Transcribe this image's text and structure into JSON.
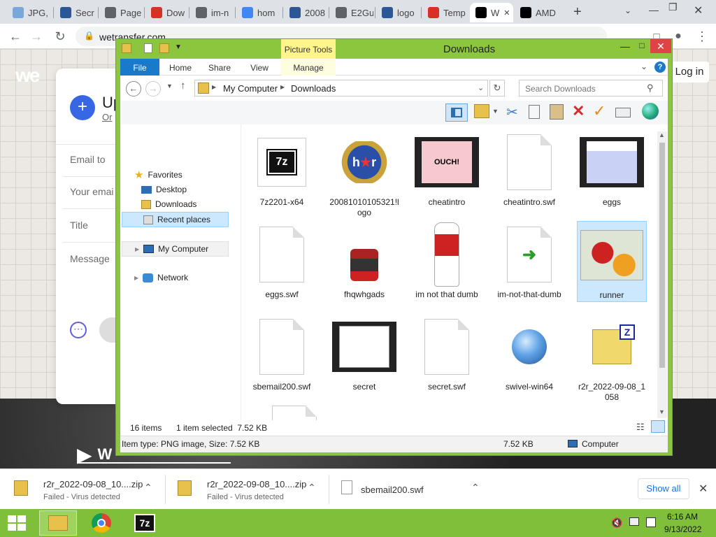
{
  "browser": {
    "tabs": [
      {
        "label": "JPG,",
        "icon": "image-icon",
        "color": "#7aa7d9"
      },
      {
        "label": "Secr",
        "icon": "site-icon",
        "color": "#2b5797"
      },
      {
        "label": "Page",
        "icon": "globe-icon",
        "color": "#5f6368"
      },
      {
        "label": "Dow",
        "icon": "download-icon",
        "color": "#d93025"
      },
      {
        "label": "im-n",
        "icon": "globe-icon",
        "color": "#5f6368"
      },
      {
        "label": "hom",
        "icon": "google-icon",
        "color": "#4285f4"
      },
      {
        "label": "2008",
        "icon": "site-icon",
        "color": "#2b5797"
      },
      {
        "label": "E2Gu",
        "icon": "globe-icon",
        "color": "#5f6368"
      },
      {
        "label": "logo",
        "icon": "site-icon",
        "color": "#2b5797"
      },
      {
        "label": "Temp",
        "icon": "mail-icon",
        "color": "#d93025"
      },
      {
        "label": "W",
        "icon": "wetransfer-icon",
        "color": "#000000"
      },
      {
        "label": "AMD",
        "icon": "amd-icon",
        "color": "#000000"
      }
    ],
    "url": "wetransfer.com"
  },
  "webpage": {
    "logo": "we",
    "login": "Log in",
    "upload_title": "Up",
    "upload_sub": "Or",
    "fields": [
      "Email to",
      "Your emai",
      "Title",
      "Message"
    ],
    "play_letter": "W"
  },
  "explorer": {
    "contextual_tab": "Picture Tools",
    "title": "Downloads",
    "ribbon_tabs": [
      "File",
      "Home",
      "Share",
      "View",
      "Manage"
    ],
    "breadcrumb": [
      "My Computer",
      "Downloads"
    ],
    "search_placeholder": "Search Downloads",
    "nav": {
      "favorites": "Favorites",
      "items": [
        "Desktop",
        "Downloads",
        "Recent places"
      ],
      "my_computer": "My Computer",
      "network": "Network"
    },
    "files": [
      {
        "name": "7z2201-x64",
        "kind": "app7z"
      },
      {
        "name": "20081010105321!logo",
        "kind": "logo"
      },
      {
        "name": "cheatintro",
        "kind": "film-pink"
      },
      {
        "name": "cheatintro.swf",
        "kind": "doc"
      },
      {
        "name": "eggs",
        "kind": "film-text"
      },
      {
        "name": "eggs.swf",
        "kind": "doc"
      },
      {
        "name": "fhqwhgads",
        "kind": "sprite"
      },
      {
        "name": "im not that dumb",
        "kind": "figure"
      },
      {
        "name": "im-not-that-dumb",
        "kind": "doc-arrow"
      },
      {
        "name": "runner",
        "kind": "flowers",
        "selected": true
      },
      {
        "name": "sbemail200.swf",
        "kind": "doc"
      },
      {
        "name": "secret",
        "kind": "film-doc"
      },
      {
        "name": "secret.swf",
        "kind": "doc"
      },
      {
        "name": "swivel-win64",
        "kind": "setup"
      },
      {
        "name": "r2r_2022-09-08_1058",
        "kind": "zip"
      }
    ],
    "status_count": "16 items",
    "status_selected": "1 item selected  7.52 KB",
    "details_type": "Item type: PNG image, Size: 7.52 KB",
    "details_size": "7.52 KB",
    "details_location": "Computer"
  },
  "downloads_shelf": {
    "items": [
      {
        "name": "r2r_2022-09-08_10....zip",
        "status": "Failed - Virus detected"
      },
      {
        "name": "r2r_2022-09-08_10....zip",
        "status": "Failed - Virus detected"
      },
      {
        "name": "sbemail200.swf",
        "status": ""
      }
    ],
    "show_all": "Show all"
  },
  "taskbar": {
    "time": "6:16 AM",
    "date": "9/13/2022"
  }
}
